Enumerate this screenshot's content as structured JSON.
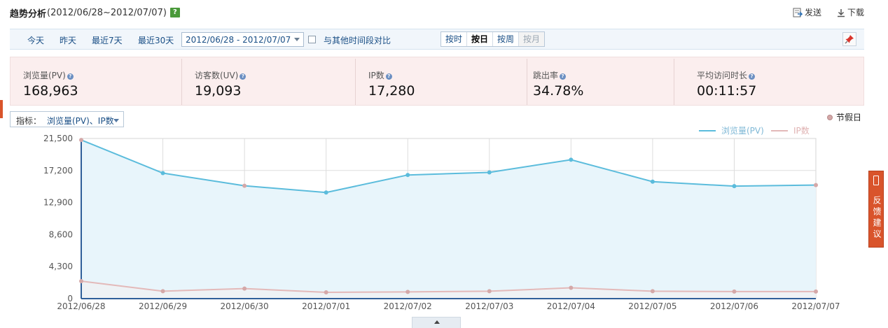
{
  "header": {
    "title": "趋势分析",
    "range": "(2012/06/28~2012/07/07)",
    "help_glyph": "?"
  },
  "actions": {
    "send_label": "发送",
    "download_label": "下载"
  },
  "toolbar": {
    "quick_ranges": [
      "今天",
      "昨天",
      "最近7天",
      "最近30天"
    ],
    "date_range_value": "2012/06/28 - 2012/07/07",
    "compare_label": "与其他时间段对比",
    "compare_checked": false,
    "granularity": [
      {
        "label": "按时",
        "state": "normal"
      },
      {
        "label": "按日",
        "state": "active"
      },
      {
        "label": "按周",
        "state": "normal"
      },
      {
        "label": "按月",
        "state": "disabled"
      }
    ]
  },
  "metrics": [
    {
      "label": "浏览量(PV)",
      "value": "168,963"
    },
    {
      "label": "访客数(UV)",
      "value": "19,093"
    },
    {
      "label": "IP数",
      "value": "17,280"
    },
    {
      "label": "跳出率",
      "value": "34.78%"
    },
    {
      "label": "平均访问时长",
      "value": "00:11:57"
    }
  ],
  "indicator": {
    "label": "指标：",
    "value": "浏览量(PV)、IP数"
  },
  "holiday_legend": "节假日",
  "feedback_label": "反馈建议",
  "colors": {
    "pv_line": "#5bbcdc",
    "pv_fill": "#e8f5fb",
    "ip_line": "#e3b9b9",
    "holiday_dot": "#d4a8a8",
    "accent_red": "#d9542b",
    "link_blue": "#1a4f86"
  },
  "chart_data": {
    "type": "line",
    "categories": [
      "2012/06/28",
      "2012/06/29",
      "2012/06/30",
      "2012/07/01",
      "2012/07/02",
      "2012/07/03",
      "2012/07/04",
      "2012/07/05",
      "2012/07/06",
      "2012/07/07"
    ],
    "y_ticks": [
      "21,500",
      "17,200",
      "12,900",
      "8,600",
      "4,300",
      "0"
    ],
    "ylim": [
      0,
      21500
    ],
    "grid": true,
    "legend_position": "top-right",
    "series": [
      {
        "name": "浏览量(PV)",
        "values": [
          21300,
          16850,
          15150,
          14250,
          16600,
          16950,
          18650,
          15700,
          15100,
          15250
        ],
        "area": true
      },
      {
        "name": "IP数",
        "values": [
          2350,
          1000,
          1350,
          850,
          900,
          1000,
          1450,
          1000,
          950,
          950
        ],
        "area": false
      }
    ],
    "holiday_points": [
      0,
      2,
      9
    ]
  }
}
